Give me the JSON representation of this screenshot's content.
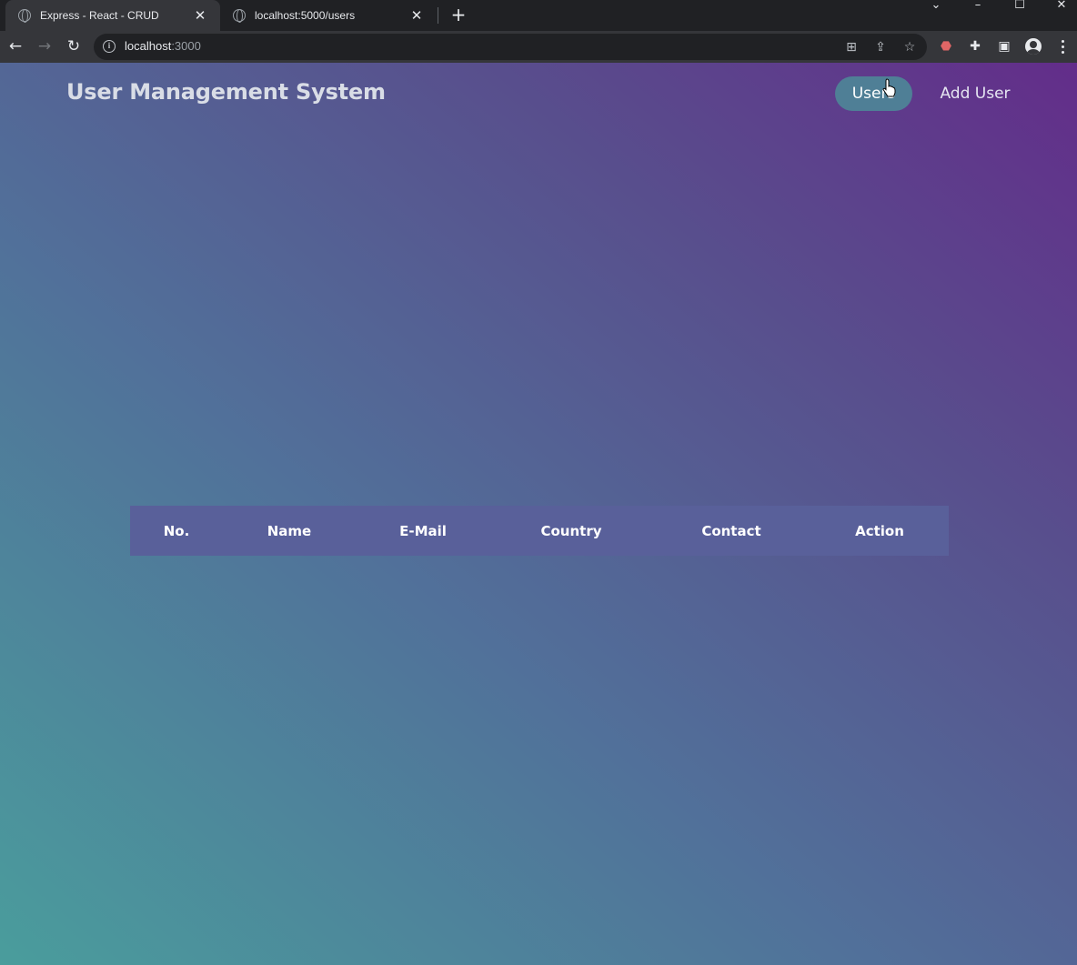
{
  "browser": {
    "tabs": [
      {
        "title": "Express - React - CRUD",
        "active": true
      },
      {
        "title": "localhost:5000/users",
        "active": false
      }
    ],
    "address": {
      "host": "localhost",
      "port": ":3000"
    }
  },
  "app": {
    "title": "User Management System",
    "nav": {
      "users": "Users",
      "add_user": "Add User"
    },
    "table": {
      "columns": [
        "No.",
        "Name",
        "E-Mail",
        "Country",
        "Contact",
        "Action"
      ],
      "rows": []
    }
  },
  "colors": {
    "gradient": [
      "#4a9d9c",
      "#51719a",
      "#584f8d",
      "#632d8a"
    ],
    "table_header": "#59609a",
    "active_nav": "#4f7f96"
  },
  "icons": [
    "globe-icon",
    "close-icon",
    "plus-icon",
    "chevron-down-icon",
    "minimize-icon",
    "maximize-icon",
    "window-close-icon",
    "back-arrow-icon",
    "forward-arrow-icon",
    "reload-icon",
    "info-icon",
    "translate-icon",
    "share-icon",
    "star-icon",
    "extension-icon",
    "puzzle-icon",
    "side-panel-icon",
    "profile-icon",
    "menu-icon",
    "cursor-icon"
  ]
}
